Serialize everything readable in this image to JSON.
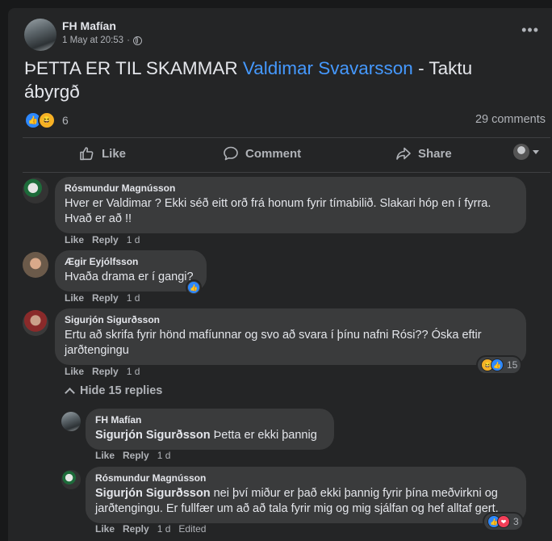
{
  "post": {
    "author": "FH Mafían",
    "date": "1 May at 20:53",
    "separator": "·",
    "more": "•••",
    "text_before": "ÞETTA ER TIL SKAMMAR ",
    "mention": "Valdimar Svavarsson",
    "text_after": " - Taktu ábyrgð",
    "reaction_count": "6",
    "comments_label": "29 comments",
    "reactions": [
      "like",
      "haha"
    ]
  },
  "actions": {
    "like": "Like",
    "comment": "Comment",
    "share": "Share"
  },
  "comments": [
    {
      "name": "Rósmundur Magnússon",
      "text": "Hver er Valdimar ? Ekki séð eitt orð frá honum fyrir tímabilið. Slakari hóp en í fyrra. Hvað er að !!",
      "like": "Like",
      "reply": "Reply",
      "time": "1 d"
    },
    {
      "name": "Ægir Eyjólfsson",
      "text": "Hvaða drama er í gangi?",
      "like": "Like",
      "reply": "Reply",
      "time": "1 d",
      "reactions": [
        "like"
      ]
    },
    {
      "name": "Sigurjón Sigurðsson",
      "text": "Ertu að skrifa fyrir hönd mafíunnar og svo að svara í þínu nafni Rósi?? Óska eftir jarðtengingu",
      "like": "Like",
      "reply": "Reply",
      "time": "1 d",
      "reactions": [
        "haha",
        "like"
      ],
      "reaction_count": "15"
    }
  ],
  "hide_replies": "Hide 15 replies",
  "replies": [
    {
      "name": "FH Mafían",
      "tag": "Sigurjón Sigurðsson",
      "text": " Þetta er ekki þannig",
      "like": "Like",
      "reply": "Reply",
      "time": "1 d"
    },
    {
      "name": "Rósmundur Magnússon",
      "tag": "Sigurjón Sigurðsson",
      "text": " nei því miður er það ekki þannig fyrir þína meðvirkni og jarðtengingu. Er fullfær um að að tala fyrir mig og mig sjálfan og hef alltaf gert.",
      "like": "Like",
      "reply": "Reply",
      "time": "1 d",
      "edited": "Edited",
      "reactions": [
        "like",
        "love"
      ],
      "reaction_count": "3"
    }
  ],
  "colors": {
    "background": "#18191a",
    "card": "#242526",
    "bubble": "#3a3b3c",
    "mention": "#4599ff",
    "like_blue": "#2d88ff",
    "haha_yellow": "#f7b125",
    "love_red": "#f33e58"
  },
  "icons": [
    "globe-icon",
    "more-icon",
    "thumbs-up-icon",
    "comment-icon",
    "share-icon",
    "chevron-up-icon",
    "caret-down-icon"
  ]
}
